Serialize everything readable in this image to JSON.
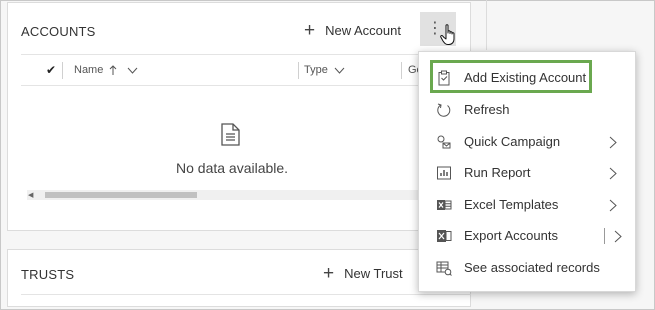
{
  "accounts": {
    "title": "ACCOUNTS",
    "new_label": "New Account",
    "columns": [
      "Name",
      "Type",
      "Gen"
    ],
    "empty_text": "No data available."
  },
  "trusts": {
    "title": "TRUSTS",
    "new_label": "New Trust"
  },
  "menu": {
    "items": [
      {
        "label": "Add Existing Account",
        "icon": "clipboard-icon",
        "submenu": false
      },
      {
        "label": "Refresh",
        "icon": "refresh-icon",
        "submenu": false
      },
      {
        "label": "Quick Campaign",
        "icon": "quick-campaign-icon",
        "submenu": true
      },
      {
        "label": "Run Report",
        "icon": "report-icon",
        "submenu": true
      },
      {
        "label": "Excel Templates",
        "icon": "excel-template-icon",
        "submenu": true
      },
      {
        "label": "Export Accounts",
        "icon": "excel-export-icon",
        "submenu": true
      },
      {
        "label": "See associated records",
        "icon": "associated-records-icon",
        "submenu": false
      }
    ],
    "highlight_color": "#6aa84f"
  }
}
